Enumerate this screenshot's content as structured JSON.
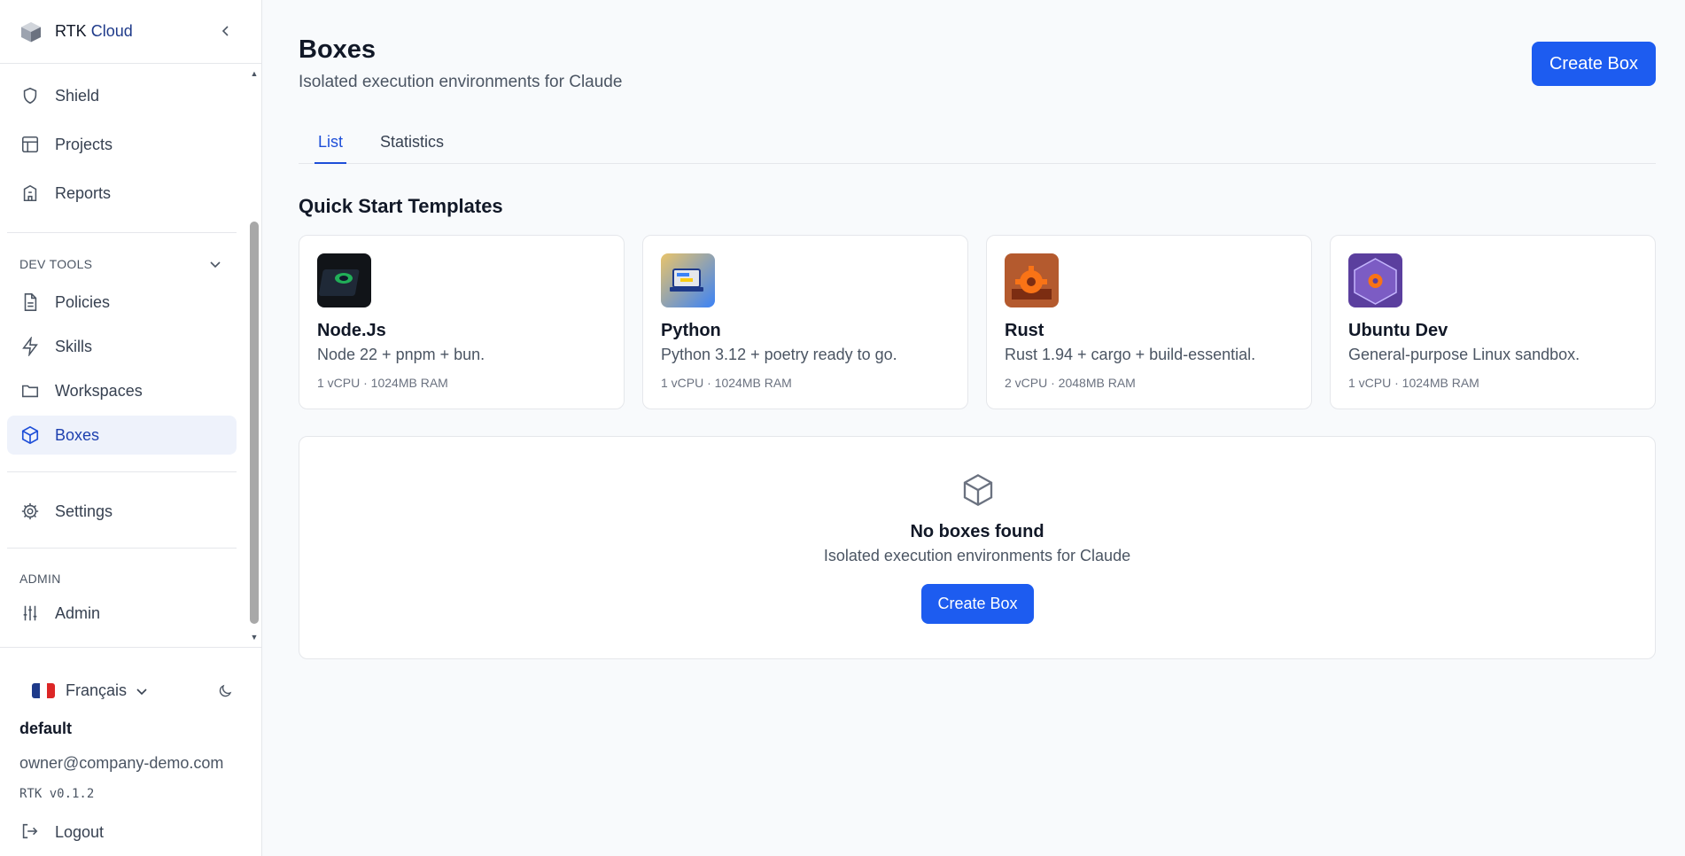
{
  "brand": {
    "name_part1": "RTK",
    "name_part2": "Cloud"
  },
  "sidebar": {
    "items": [
      {
        "label": "Shield",
        "icon": "shield-icon"
      },
      {
        "label": "Projects",
        "icon": "table-icon"
      },
      {
        "label": "Reports",
        "icon": "building-icon"
      }
    ],
    "devtools": {
      "label": "DEV TOOLS",
      "items": [
        {
          "label": "Policies",
          "icon": "document-icon"
        },
        {
          "label": "Skills",
          "icon": "lightning-icon"
        },
        {
          "label": "Workspaces",
          "icon": "folder-icon"
        },
        {
          "label": "Boxes",
          "icon": "cube-icon",
          "active": true
        }
      ]
    },
    "settings": {
      "label": "Settings",
      "icon": "gear-icon"
    },
    "admin": {
      "section_label": "ADMIN",
      "label": "Admin",
      "icon": "sliders-icon"
    }
  },
  "footer": {
    "language": "Français",
    "account_name": "default",
    "email": "owner@company-demo.com",
    "version": "RTK v0.1.2",
    "logout": "Logout"
  },
  "page": {
    "title": "Boxes",
    "subtitle": "Isolated execution environments for Claude",
    "create_button": "Create Box"
  },
  "tabs": [
    {
      "label": "List",
      "active": true
    },
    {
      "label": "Statistics",
      "active": false
    }
  ],
  "templates": {
    "title": "Quick Start Templates",
    "items": [
      {
        "name": "Node.Js",
        "description": "Node 22 + pnpm + bun.",
        "specs": "1 vCPU · 1024MB RAM"
      },
      {
        "name": "Python",
        "description": "Python 3.12 + poetry ready to go.",
        "specs": "1 vCPU · 1024MB RAM"
      },
      {
        "name": "Rust",
        "description": "Rust 1.94 + cargo + build-essential.",
        "specs": "2 vCPU · 2048MB RAM"
      },
      {
        "name": "Ubuntu Dev",
        "description": "General-purpose Linux sandbox.",
        "specs": "1 vCPU · 1024MB RAM"
      }
    ]
  },
  "empty_state": {
    "title": "No boxes found",
    "subtitle": "Isolated execution environments for Claude",
    "button": "Create Box"
  },
  "colors": {
    "accent": "#1d5cf0",
    "active_nav_bg": "#eef2fb",
    "border": "#e5e7eb",
    "background": "#f8fafc"
  }
}
